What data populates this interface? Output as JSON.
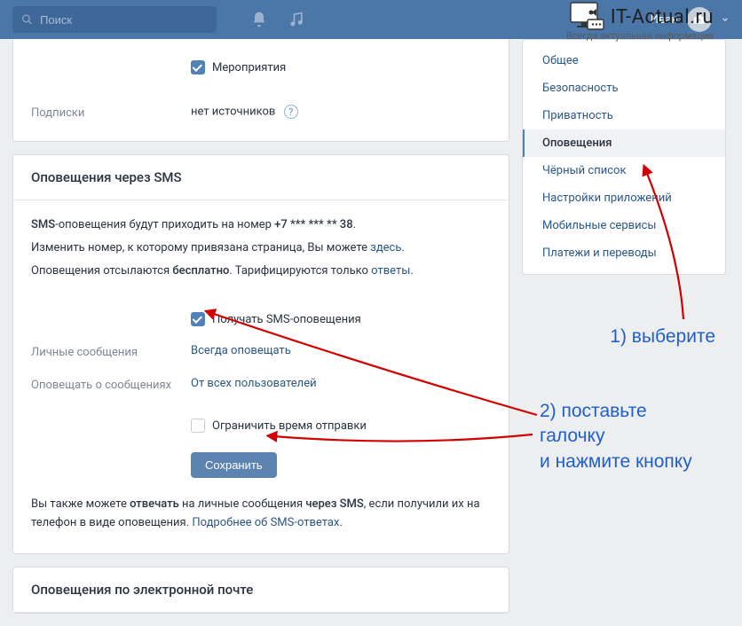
{
  "header": {
    "search_placeholder": "Поиск",
    "username": "Иван"
  },
  "watermark": {
    "brand": "IT-Actual.ru",
    "slogan": "Всегда актуальная информация"
  },
  "top_panel": {
    "events_checkbox_label": "Мероприятия",
    "subscriptions_label": "Подписки",
    "subscriptions_value": "нет источников"
  },
  "sms_panel": {
    "title": "Оповещения через SMS",
    "line1_prefix": "SMS",
    "line1_rest": "-оповещения будут приходить на номер ",
    "phone": "+7 *** *** ** 38",
    "line2_a": "Изменить номер, к которому привязана страница, Вы можете ",
    "line2_link": "здесь",
    "line3_a": "Оповещения отсылаются ",
    "line3_b": "бесплатно",
    "line3_c": ". Тарифицируются только ",
    "line3_link": "ответы",
    "receive_label": "Получать SMS-оповещения",
    "private_label": "Личные сообщения",
    "private_value": "Всегда оповещать",
    "notify_about_label": "Оповещать о сообщениях",
    "notify_about_value": "От всех пользователей",
    "limit_time_label": "Ограничить время отправки",
    "save_label": "Сохранить",
    "footer_a": "Вы также можете ",
    "footer_b": "отвечать",
    "footer_c": " на личные сообщения ",
    "footer_d": "через SMS",
    "footer_e": ", если получили их на телефон в виде оповещения. ",
    "footer_link": "Подробнее об SMS-ответах"
  },
  "email_panel": {
    "title": "Оповещения по электронной почте"
  },
  "sidebar": {
    "items": [
      {
        "label": "Общее"
      },
      {
        "label": "Безопасность"
      },
      {
        "label": "Приватность"
      },
      {
        "label": "Оповещения"
      },
      {
        "label": "Чёрный список"
      },
      {
        "label": "Настройки приложений"
      },
      {
        "label": "Мобильные сервисы"
      },
      {
        "label": "Платежи и переводы"
      }
    ]
  },
  "annotations": {
    "step1": "1) выберите",
    "step2": "2) поставьте\nгалочку\nи нажмите кнопку"
  }
}
